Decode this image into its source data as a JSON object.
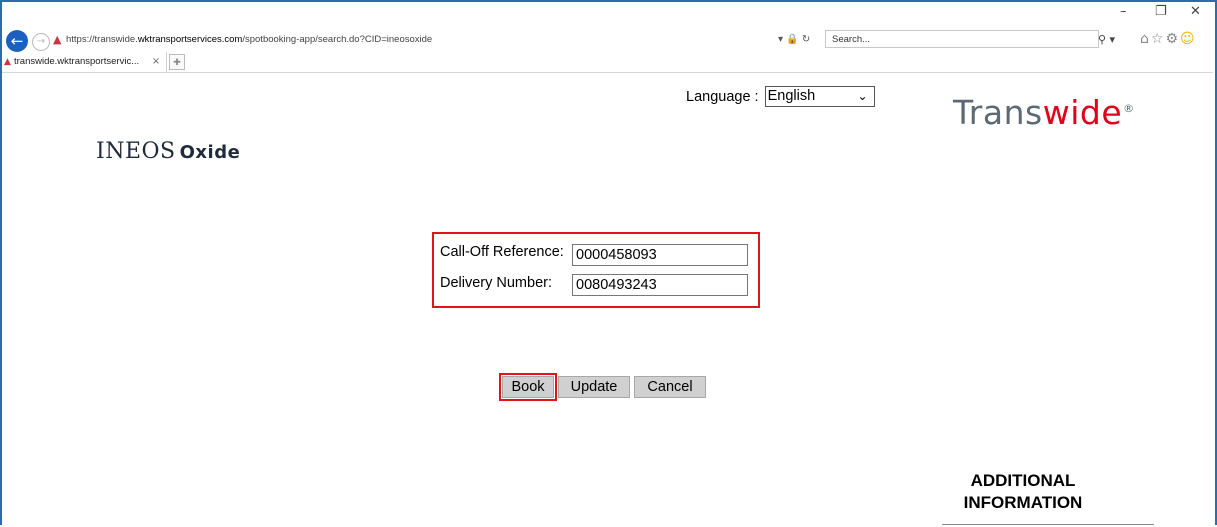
{
  "browser": {
    "url_prefix": "https://transwide.",
    "url_domain": "wktransportservices.com",
    "url_path": "/spotbooking-app/search.do?CID=ineosoxide",
    "search_placeholder": "Search...",
    "tab_title": "transwide.wktransportservic...",
    "window_controls": {
      "minimize": "–",
      "restore": "❐",
      "close": "✕"
    }
  },
  "header": {
    "language_label": "Language :",
    "language_value": "English",
    "transwide_logo_a": "Trans",
    "transwide_logo_b": "wide",
    "ineos_logo": "INEOS",
    "ineos_oxide": "Oxide"
  },
  "form": {
    "calloff_label": "Call-Off Reference:",
    "calloff_value": "0000458093",
    "delivery_label": "Delivery Number:",
    "delivery_value": "0080493243"
  },
  "buttons": {
    "book": "Book",
    "update": "Update",
    "cancel": "Cancel"
  },
  "sidebar": {
    "additional_info_1": "ADDITIONAL",
    "additional_info_2": "INFORMATION"
  },
  "colors": {
    "highlight_red": "#e0141c",
    "transwide_red": "#e2001a",
    "transwide_gray": "#5d6a74",
    "frame_blue": "#2b6cb0"
  }
}
